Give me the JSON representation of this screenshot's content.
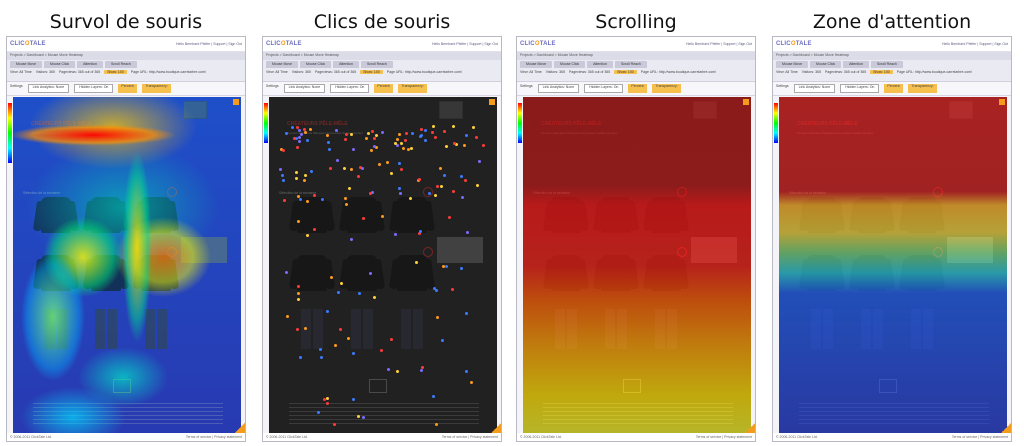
{
  "captions": [
    "Survol de souris",
    "Clics de souris",
    "Scrolling",
    "Zone d'attention"
  ],
  "app": {
    "logo": "CLIC",
    "logo_o": "O",
    "logo_tail": "TALE",
    "top_links": "Hello Bernhard Pfeifer | Support | Sign Out",
    "breadcrumb": "Projects > Dashboard > Mouse Move Heatmap",
    "tabs": [
      "Mouse Move",
      "Mouse Click",
      "Attention",
      "Scroll Reach"
    ],
    "stats": [
      "View: All Time",
      "Visitors: 365",
      "Pageviews: 365 out of 365",
      "Show: 100",
      "Page URL: http://www.boutique-carrelarbre.com/"
    ],
    "settings_label": "Settings",
    "settings_fields": [
      "Link Analytics: None",
      "Hidden Layers: On",
      "Percent:",
      "Transparency:"
    ],
    "footer_left": "© 2006-2011 ClickTale Ltd.",
    "footer_right": "Terms of service | Privacy statement"
  },
  "page": {
    "title": "CRÉATEURS  PÊLE-MÊLE",
    "nav": "Accueil   Collections   Marques   Nouveautés   Soldes   Contact",
    "section": "Sélection de la semaine"
  },
  "colors": {
    "heat_background": "#3234a6",
    "dark_background": "#2d2d2d",
    "accent_orange": "#f29b1d",
    "logo_purple": "#6d6dbf"
  }
}
